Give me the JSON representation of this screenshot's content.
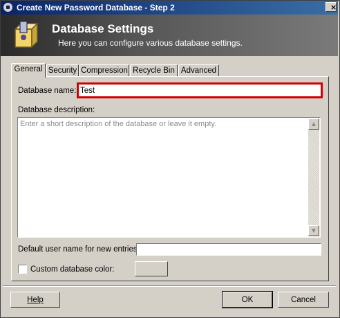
{
  "window": {
    "title": "Create New Password Database - Step 2",
    "close_glyph": "×"
  },
  "banner": {
    "title": "Database Settings",
    "subtitle": "Here you can configure various database settings.",
    "icon": "database-wizard-icon"
  },
  "tabs": [
    {
      "label": "General",
      "active": true
    },
    {
      "label": "Security",
      "active": false
    },
    {
      "label": "Compression",
      "active": false
    },
    {
      "label": "Recycle Bin",
      "active": false
    },
    {
      "label": "Advanced",
      "active": false
    }
  ],
  "general": {
    "name_label": "Database name:",
    "name_value": "Test",
    "description_label": "Database description:",
    "description_placeholder": "Enter a short description of the database or leave it empty.",
    "description_value": "",
    "username_label": "Default user name for new entries:",
    "username_value": "",
    "custom_color_label": "Custom database color:",
    "custom_color_checked": false
  },
  "scrollbar": {
    "up_glyph": "▲",
    "down_glyph": "▼"
  },
  "buttons": {
    "help": "Help",
    "ok": "OK",
    "cancel": "Cancel"
  },
  "colors": {
    "highlight_border": "#d40000",
    "title_gradient_start": "#0a246a",
    "title_gradient_end": "#3a6ea5"
  }
}
